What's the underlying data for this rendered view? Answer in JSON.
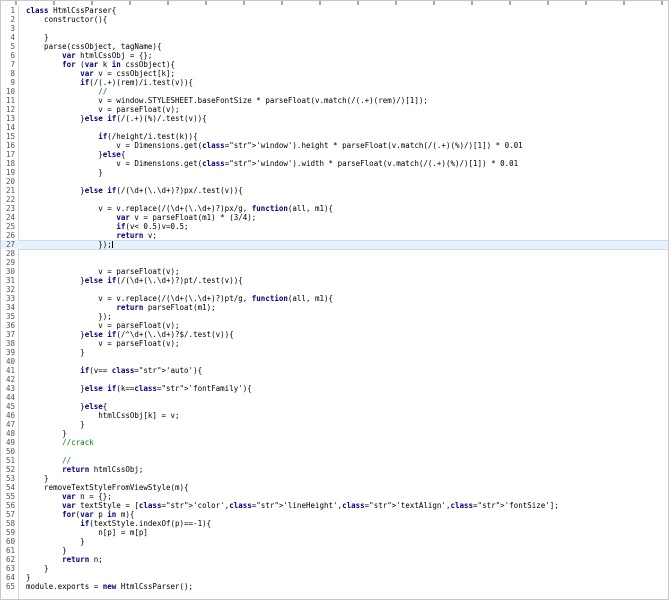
{
  "editor": {
    "current_line": 27,
    "lines": [
      {
        "n": "1",
        "t": "class HtmlCssParser{"
      },
      {
        "n": "2",
        "t": "    constructor(){"
      },
      {
        "n": "3",
        "t": ""
      },
      {
        "n": "4",
        "t": "    }"
      },
      {
        "n": "5",
        "t": "    parse(cssObject, tagName){"
      },
      {
        "n": "6",
        "t": "        var htmlCssObj = {};"
      },
      {
        "n": "7",
        "t": "        for (var k in cssObject){"
      },
      {
        "n": "8",
        "t": "            var v = cssObject[k];"
      },
      {
        "n": "9",
        "t": "            if(/(.+)(rem)/i.test(v)){"
      },
      {
        "n": "10",
        "t": "                //"
      },
      {
        "n": "11",
        "t": "                v = window.STYLESHEET.baseFontSize * parseFloat(v.match(/(.+)(rem)/)[1]);"
      },
      {
        "n": "12",
        "t": "                v = parseFloat(v);"
      },
      {
        "n": "13",
        "t": "            }else if(/(.+)(%)/.test(v)){"
      },
      {
        "n": "14",
        "t": ""
      },
      {
        "n": "15",
        "t": "                if(/height/i.test(k)){"
      },
      {
        "n": "16",
        "t": "                    v = Dimensions.get('window').height * parseFloat(v.match(/(.+)(%)/)[1]) * 0.01"
      },
      {
        "n": "17",
        "t": "                }else{"
      },
      {
        "n": "18",
        "t": "                    v = Dimensions.get('window').width * parseFloat(v.match(/(.+)(%)/)[1]) * 0.01"
      },
      {
        "n": "19",
        "t": "                }"
      },
      {
        "n": "20",
        "t": ""
      },
      {
        "n": "21",
        "t": "            }else if(/(\\d+(\\.\\d+)?)px/.test(v)){"
      },
      {
        "n": "22",
        "t": ""
      },
      {
        "n": "23",
        "t": "                v = v.replace(/(\\d+(\\.\\d+)?)px/g, function(all, m1){"
      },
      {
        "n": "24",
        "t": "                    var v = parseFloat(m1) * (3/4);"
      },
      {
        "n": "25",
        "t": "                    if(v< 0.5)v=0.5;"
      },
      {
        "n": "26",
        "t": "                    return v;"
      },
      {
        "n": "27",
        "t": "                });"
      },
      {
        "n": "28",
        "t": ""
      },
      {
        "n": "29",
        "t": ""
      },
      {
        "n": "30",
        "t": "                v = parseFloat(v);"
      },
      {
        "n": "31",
        "t": "            }else if(/(\\d+(\\.\\d+)?)pt/.test(v)){"
      },
      {
        "n": "32",
        "t": ""
      },
      {
        "n": "33",
        "t": "                v = v.replace(/(\\d+(\\.\\d+)?)pt/g, function(all, m1){"
      },
      {
        "n": "34",
        "t": "                    return parseFloat(m1);"
      },
      {
        "n": "35",
        "t": "                });"
      },
      {
        "n": "36",
        "t": "                v = parseFloat(v);"
      },
      {
        "n": "37",
        "t": "            }else if(/^\\d+(\\.\\d+)?$/.test(v)){"
      },
      {
        "n": "38",
        "t": "                v = parseFloat(v);"
      },
      {
        "n": "39",
        "t": "            }"
      },
      {
        "n": "40",
        "t": ""
      },
      {
        "n": "41",
        "t": "            if(v== 'auto'){"
      },
      {
        "n": "42",
        "t": ""
      },
      {
        "n": "43",
        "t": "            }else if(k=='fontFamily'){"
      },
      {
        "n": "44",
        "t": ""
      },
      {
        "n": "45",
        "t": "            }else{"
      },
      {
        "n": "46",
        "t": "                htmlCssObj[k] = v;"
      },
      {
        "n": "47",
        "t": "            }"
      },
      {
        "n": "48",
        "t": "        }"
      },
      {
        "n": "49",
        "t": "        //crack"
      },
      {
        "n": "50",
        "t": ""
      },
      {
        "n": "51",
        "t": "        //"
      },
      {
        "n": "52",
        "t": "        return htmlCssObj;"
      },
      {
        "n": "53",
        "t": "    }"
      },
      {
        "n": "54",
        "t": "    removeTextStyleFromViewStyle(m){"
      },
      {
        "n": "55",
        "t": "        var n = {};"
      },
      {
        "n": "56",
        "t": "        var textStyle = ['color','lineHeight','textAlign','fontSize'];"
      },
      {
        "n": "57",
        "t": "        for(var p in m){"
      },
      {
        "n": "58",
        "t": "            if(textStyle.indexOf(p)==-1){"
      },
      {
        "n": "59",
        "t": "                n[p] = m[p]"
      },
      {
        "n": "60",
        "t": "            }"
      },
      {
        "n": "61",
        "t": "        }"
      },
      {
        "n": "62",
        "t": "        return n;"
      },
      {
        "n": "63",
        "t": "    }"
      },
      {
        "n": "64",
        "t": "}"
      },
      {
        "n": "65",
        "t": "module.exports = new HtmlCssParser();"
      }
    ]
  }
}
